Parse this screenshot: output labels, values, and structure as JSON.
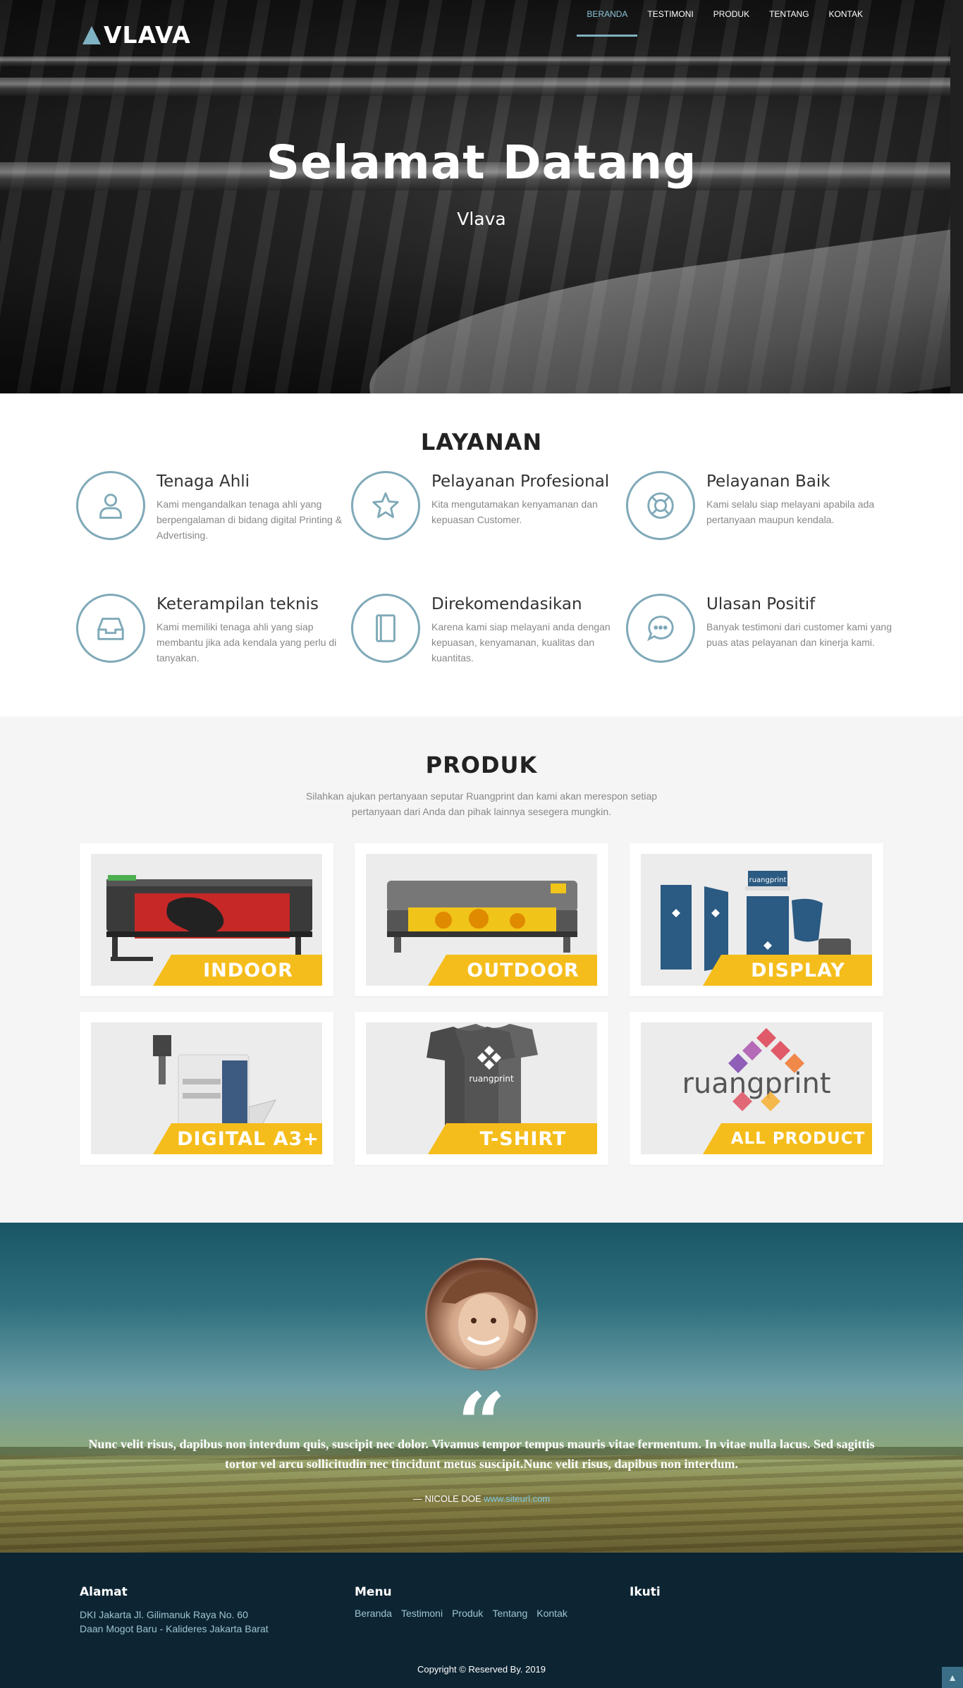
{
  "brand": {
    "name": "VLAVA",
    "accent": "#7fb2c2"
  },
  "nav": {
    "items": [
      {
        "label": "BERANDA",
        "active": true
      },
      {
        "label": "TESTIMONI",
        "active": false
      },
      {
        "label": "PRODUK",
        "active": false
      },
      {
        "label": "TENTANG",
        "active": false
      },
      {
        "label": "KONTAK",
        "active": false
      }
    ]
  },
  "hero": {
    "title": "Selamat Datang",
    "subtitle": "Vlava"
  },
  "layanan": {
    "title": "LAYANAN",
    "items": [
      {
        "icon": "user-icon",
        "title": "Tenaga Ahli",
        "desc": "Kami mengandalkan tenaga ahli yang berpengalaman di bidang digital Printing & Advertising."
      },
      {
        "icon": "star-icon",
        "title": "Pelayanan Profesional",
        "desc": "Kita mengutamakan kenyamanan dan kepuasan Customer."
      },
      {
        "icon": "lifebuoy-icon",
        "title": "Pelayanan Baik",
        "desc": "Kami selalu siap melayani apabila ada pertanyaan maupun kendala."
      },
      {
        "icon": "inbox-icon",
        "title": "Keterampilan teknis",
        "desc": "Kami memiliki tenaga ahli yang siap membantu jika ada kendala yang perlu di tanyakan."
      },
      {
        "icon": "book-icon",
        "title": "Direkomendasikan",
        "desc": "Karena kami siap melayani anda dengan kepuasan, kenyamanan, kualitas dan kuantitas."
      },
      {
        "icon": "chat-icon",
        "title": "Ulasan Positif",
        "desc": "Banyak testimoni dari customer kami yang puas atas pelayanan dan kinerja kami."
      }
    ]
  },
  "produk": {
    "title": "PRODUK",
    "subtitle": "Silahkan ajukan pertanyaan seputar Ruangprint dan kami akan merespon setiap pertanyaan dari Anda dan pihak lainnya sesegera mungkin.",
    "band_color": "#f5bd1b",
    "items": [
      {
        "label": "INDOOR",
        "image": "indoor-printer-image"
      },
      {
        "label": "OUTDOOR",
        "image": "outdoor-printer-image"
      },
      {
        "label": "DISPLAY",
        "image": "display-banner-image"
      },
      {
        "label": "DIGITAL A3+",
        "image": "digital-copier-image"
      },
      {
        "label": "T-SHIRT",
        "image": "tshirt-image"
      },
      {
        "label": "ALL PRODUCT",
        "image": "ruangprint-logo-image",
        "logo_text": "ruangprint"
      }
    ],
    "display_logo_text": "ruangprint",
    "tshirt_logo_text": "ruangprint"
  },
  "testimoni": {
    "quote": "Nunc velit risus, dapibus non interdum quis, suscipit nec dolor. Vivamus tempor tempus mauris vitae fermentum. In vitae nulla lacus. Sed sagittis tortor vel arcu sollicitudin nec tincidunt metus suscipit.Nunc velit risus, dapibus non interdum.",
    "author": "— NICOLE DOE",
    "author_link": "www.siteurl.com"
  },
  "footer": {
    "alamat_title": "Alamat",
    "alamat_line1": "DKI Jakarta Jl. Gilimanuk Raya No. 60",
    "alamat_line2": "Daan Mogot Baru - Kalideres Jakarta Barat",
    "menu_title": "Menu",
    "menu_items": [
      "Beranda",
      "Testimoni",
      "Produk",
      "Tentang",
      "Kontak"
    ],
    "ikuti_title": "Ikuti",
    "copyright": "Copyright © Reserved By. 2019"
  }
}
